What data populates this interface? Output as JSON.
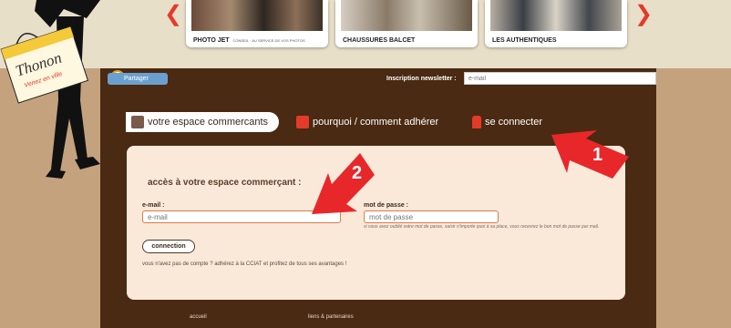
{
  "carousel": {
    "items": [
      {
        "caption": "PHOTO JET",
        "sub_caption": "CONSEIL · AU SERVICE DE VOS PHOTOS"
      },
      {
        "caption": "CHAUSSURES BALCET"
      },
      {
        "caption": "LES AUTHENTIQUES"
      }
    ]
  },
  "logo": {
    "name": "Thonon",
    "tagline": "Venez en ville"
  },
  "share": {
    "label": "Partager"
  },
  "newsletter": {
    "label": "Inscription newsletter :",
    "placeholder": "e-mail"
  },
  "tabs": [
    {
      "label": "votre espace commercants"
    },
    {
      "label": "pourquoi / comment adhérer"
    },
    {
      "label": "se connecter"
    }
  ],
  "login_form": {
    "title": "accès à votre espace commerçant :",
    "email_label": "e-mail :",
    "email_placeholder": "e-mail",
    "password_label": "mot de passe :",
    "password_placeholder": "mot de passe",
    "help_text": "si vous avez oublié votre mot de passe, saisir n'importe quoi à sa place, vous recevrez le bon mot de passe par mail.",
    "submit_label": "connection",
    "no_account_text": "vous n'avez pas de compte ? adhérez à la CCIAT et profitez de tous ses avantages !"
  },
  "annotations": [
    {
      "number": "1"
    },
    {
      "number": "2"
    }
  ],
  "footer": {
    "links": [
      "accueil",
      "liens & partenaires"
    ]
  },
  "colors": {
    "brown": "#4a2a12",
    "tan": "#c4a27e",
    "accent_red": "#e43a2a",
    "form_bg": "#fae9d9"
  }
}
